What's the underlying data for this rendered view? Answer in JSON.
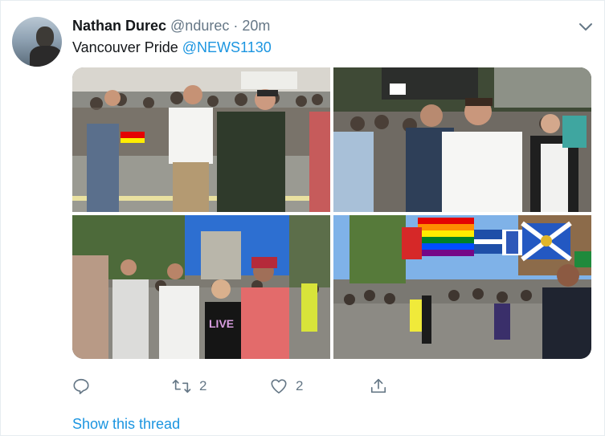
{
  "tweet": {
    "author_name": "Nathan Durec",
    "author_handle": "@ndurec",
    "separator": "·",
    "time": "20m",
    "text_prefix": "Vancouver Pride ",
    "mention": "@NEWS1130"
  },
  "media": {
    "count": 4,
    "flag_colors": [
      "#e40303",
      "#ff8c00",
      "#ffed00",
      "#008026",
      "#004dff",
      "#750787"
    ]
  },
  "actions": {
    "reply_count": "",
    "retweet_count": "2",
    "like_count": "2"
  },
  "thread_link": "Show this thread",
  "icons": [
    "caret-down-icon",
    "reply-icon",
    "retweet-icon",
    "like-icon",
    "share-icon"
  ],
  "colors": {
    "accent": "#1b95e0",
    "muted": "#657786",
    "text": "#14171a",
    "border": "#e6ecf0"
  }
}
